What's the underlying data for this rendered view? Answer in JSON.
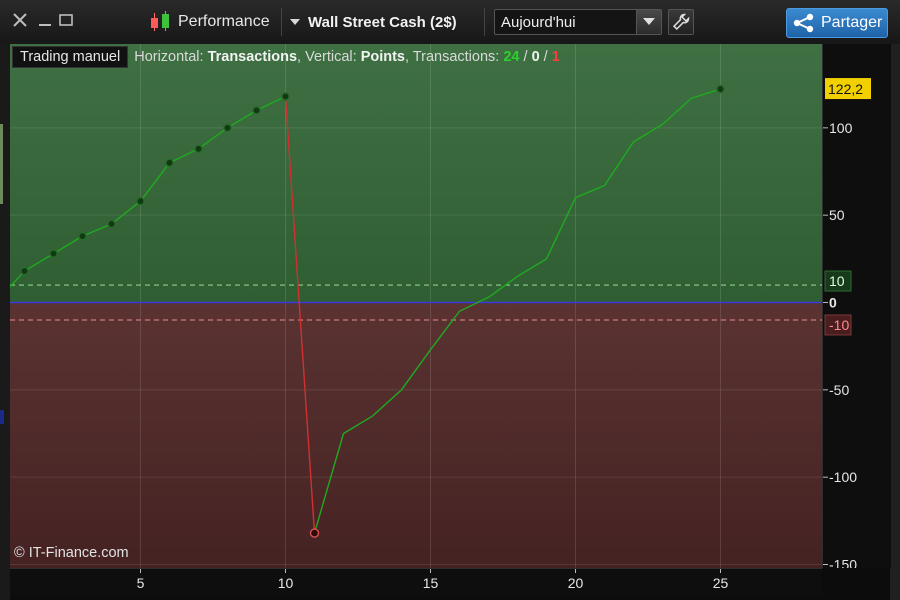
{
  "toolbar": {
    "close_icon": "close-icon",
    "minimize_icon": "minimize-icon",
    "maximize_icon": "maximize-icon",
    "performance_label": "Performance",
    "instrument_label": "Wall Street Cash (2$)",
    "period_value": "Aujourd'hui",
    "share_label": "Partager"
  },
  "legend": {
    "mode_button": "Trading manuel",
    "horizontal_prefix": "Horizontal: ",
    "horizontal_value": "Transactions",
    "vertical_prefix": ", Vertical: ",
    "vertical_value": "Points",
    "transactions_prefix": ", Transactions: ",
    "count_win": "24",
    "slash1": " / ",
    "count_neutral": "0",
    "slash2": " / ",
    "count_loss": "1"
  },
  "copyright": "© IT-Finance.com",
  "colors": {
    "profit_zone": "#3a6a3e",
    "loss_zone": "#5a2c2c",
    "line_up": "#1faa1f",
    "line_down": "#d03030",
    "zero_line": "#3a3ad8",
    "upper_band": "#8bd08b",
    "lower_band": "#d07a7a",
    "last_value_badge": "#f2d000",
    "accent_share": "#2a7bc4"
  },
  "chart_data": {
    "type": "line",
    "x": [
      0,
      1,
      2,
      3,
      4,
      5,
      6,
      7,
      8,
      9,
      10,
      11,
      12,
      13,
      14,
      15,
      16,
      17,
      18,
      19,
      20,
      21,
      22,
      23,
      24,
      25
    ],
    "y": [
      0,
      18,
      28,
      38,
      45,
      58,
      80,
      88,
      100,
      110,
      118,
      -132,
      -75,
      -65,
      -50,
      -27,
      -5,
      3,
      15,
      25,
      60,
      67,
      92,
      102,
      117,
      122.2
    ],
    "marker_x": [
      1,
      2,
      3,
      4,
      5,
      6,
      7,
      8,
      9,
      10,
      11,
      25
    ],
    "loss_segment": [
      10,
      11
    ],
    "xlim": [
      0.5,
      28.5
    ],
    "ylim": [
      -152,
      148
    ],
    "x_ticks": [
      5,
      10,
      15,
      20,
      25
    ],
    "y_ticks": [
      100,
      50,
      0,
      -50,
      -100,
      -150
    ],
    "y_tick_labels": [
      "100",
      "50",
      "0",
      "-50",
      "-100",
      "-150"
    ],
    "bands": [
      10,
      -10
    ],
    "band_labels": [
      "10",
      "-10"
    ],
    "last_value_label": "122,2",
    "grid": true
  }
}
